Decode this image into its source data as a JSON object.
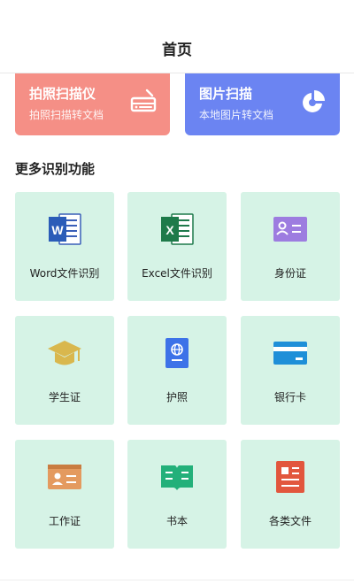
{
  "header": {
    "title": "首页"
  },
  "cards": {
    "photo": {
      "title": "拍照扫描仪",
      "subtitle": "拍照扫描转文档"
    },
    "image": {
      "title": "图片扫描",
      "subtitle": "本地图片转文档"
    }
  },
  "section": {
    "title": "更多识别功能"
  },
  "tiles": [
    {
      "label": "Word文件识别",
      "icon": "word-icon"
    },
    {
      "label": "Excel文件识别",
      "icon": "excel-icon"
    },
    {
      "label": "身份证",
      "icon": "id-card-icon"
    },
    {
      "label": "学生证",
      "icon": "graduation-cap-icon"
    },
    {
      "label": "护照",
      "icon": "passport-icon"
    },
    {
      "label": "银行卡",
      "icon": "bank-card-icon"
    },
    {
      "label": "工作证",
      "icon": "work-badge-icon"
    },
    {
      "label": "书本",
      "icon": "book-icon"
    },
    {
      "label": "各类文件",
      "icon": "document-icon"
    }
  ],
  "colors": {
    "photo_card": "#f58f86",
    "image_card": "#6b84f2",
    "tile_bg": "#d6f3e6"
  }
}
